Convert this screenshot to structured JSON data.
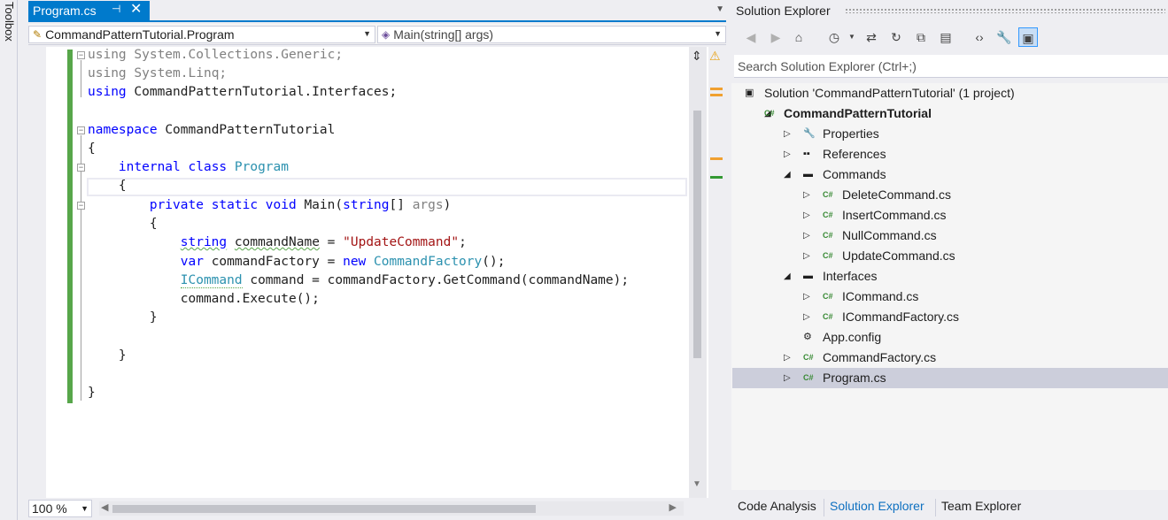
{
  "toolbox": {
    "label": "Toolbox"
  },
  "editor": {
    "tab": {
      "label": "Program.cs",
      "pin": "⊣",
      "close": "✕"
    },
    "nav": {
      "class_dropdown": "CommandPatternTutorial.Program",
      "member_dropdown": "Main(string[] args)"
    },
    "zoom": "100 %",
    "code": [
      [
        {
          "t": "using ",
          "c": "gr"
        },
        {
          "t": "System.Collections.Generic;",
          "c": "gr"
        }
      ],
      [
        {
          "t": "using ",
          "c": "gr"
        },
        {
          "t": "System.Linq;",
          "c": "gr"
        }
      ],
      [
        {
          "t": "using ",
          "c": "kw"
        },
        {
          "t": "CommandPatternTutorial.Interfaces;",
          "c": ""
        }
      ],
      [],
      [
        {
          "t": "namespace ",
          "c": "kw"
        },
        {
          "t": "CommandPatternTutorial",
          "c": ""
        }
      ],
      [
        {
          "t": "{",
          "c": ""
        }
      ],
      [
        {
          "t": "    internal ",
          "c": "kw"
        },
        {
          "t": "class ",
          "c": "kw"
        },
        {
          "t": "Program",
          "c": "ty"
        }
      ],
      [
        {
          "t": "    {",
          "c": ""
        }
      ],
      [
        {
          "t": "        private ",
          "c": "kw"
        },
        {
          "t": "static ",
          "c": "kw"
        },
        {
          "t": "void ",
          "c": "kw"
        },
        {
          "t": "Main(",
          "c": ""
        },
        {
          "t": "string",
          "c": "kw"
        },
        {
          "t": "[] ",
          "c": ""
        },
        {
          "t": "args",
          "c": "gr"
        },
        {
          "t": ")",
          "c": ""
        }
      ],
      [
        {
          "t": "        {",
          "c": ""
        }
      ],
      [
        {
          "t": "            ",
          "c": ""
        },
        {
          "t": "string",
          "c": "kw squig"
        },
        {
          "t": " ",
          "c": ""
        },
        {
          "t": "commandName",
          "c": "squig"
        },
        {
          "t": " = ",
          "c": ""
        },
        {
          "t": "\"UpdateCommand\"",
          "c": "st"
        },
        {
          "t": ";",
          "c": ""
        }
      ],
      [
        {
          "t": "            var ",
          "c": "kw"
        },
        {
          "t": "commandFactory = ",
          "c": ""
        },
        {
          "t": "new ",
          "c": "kw"
        },
        {
          "t": "CommandFactory",
          "c": "ty"
        },
        {
          "t": "();",
          "c": ""
        }
      ],
      [
        {
          "t": "            ",
          "c": ""
        },
        {
          "t": "ICommand",
          "c": "ty dotted"
        },
        {
          "t": " command = commandFactory.GetCommand(commandName);",
          "c": ""
        }
      ],
      [
        {
          "t": "            command.Execute();",
          "c": ""
        }
      ],
      [
        {
          "t": "        }",
          "c": ""
        }
      ],
      [],
      [
        {
          "t": "    }",
          "c": ""
        }
      ],
      [],
      [
        {
          "t": "}",
          "c": ""
        }
      ]
    ]
  },
  "solution_explorer": {
    "title": "Solution Explorer",
    "search_placeholder": "Search Solution Explorer (Ctrl+;)",
    "toolbar": [
      "back-icon",
      "forward-icon",
      "home-icon",
      "history-icon",
      "sync-icon",
      "refresh-icon",
      "collapse-all-icon",
      "show-all-files-icon",
      "view-code-icon",
      "properties-icon",
      "preview-icon"
    ],
    "tree": [
      {
        "label": "Solution 'CommandPatternTutorial' (1 project)",
        "level": 0,
        "exp": "",
        "icon": "solution-icon",
        "glyph": "▣"
      },
      {
        "label": "CommandPatternTutorial",
        "level": 0,
        "exp": "◢",
        "icon": "csharp-project-icon",
        "glyph": "C#",
        "bold": true
      },
      {
        "label": "Properties",
        "level": 1,
        "exp": "▷",
        "icon": "wrench-icon",
        "glyph": "🔧"
      },
      {
        "label": "References",
        "level": 1,
        "exp": "▷",
        "icon": "references-icon",
        "glyph": "▪▪"
      },
      {
        "label": "Commands",
        "level": 1,
        "exp": "◢",
        "icon": "folder-icon",
        "glyph": "▬"
      },
      {
        "label": "DeleteCommand.cs",
        "level": 2,
        "exp": "▷",
        "icon": "csharp-file-icon",
        "glyph": "C#"
      },
      {
        "label": "InsertCommand.cs",
        "level": 2,
        "exp": "▷",
        "icon": "csharp-file-icon",
        "glyph": "C#"
      },
      {
        "label": "NullCommand.cs",
        "level": 2,
        "exp": "▷",
        "icon": "csharp-file-icon",
        "glyph": "C#"
      },
      {
        "label": "UpdateCommand.cs",
        "level": 2,
        "exp": "▷",
        "icon": "csharp-file-icon",
        "glyph": "C#"
      },
      {
        "label": "Interfaces",
        "level": 1,
        "exp": "◢",
        "icon": "folder-icon",
        "glyph": "▬"
      },
      {
        "label": "ICommand.cs",
        "level": 2,
        "exp": "▷",
        "icon": "csharp-file-icon",
        "glyph": "C#"
      },
      {
        "label": "ICommandFactory.cs",
        "level": 2,
        "exp": "▷",
        "icon": "csharp-file-icon",
        "glyph": "C#"
      },
      {
        "label": "App.config",
        "level": 1,
        "exp": "",
        "icon": "config-icon",
        "glyph": "⚙"
      },
      {
        "label": "CommandFactory.cs",
        "level": 1,
        "exp": "▷",
        "icon": "csharp-file-icon",
        "glyph": "C#"
      },
      {
        "label": "Program.cs",
        "level": 1,
        "exp": "▷",
        "icon": "csharp-file-icon",
        "glyph": "C#",
        "selected": true
      }
    ],
    "bottom_tabs": [
      {
        "label": "Code Analysis",
        "active": false
      },
      {
        "label": "Solution Explorer",
        "active": true
      },
      {
        "label": "Team Explorer",
        "active": false
      }
    ]
  },
  "colors": {
    "accent": "#007ACC",
    "keyword": "#0000FF",
    "type": "#2B91AF",
    "string": "#A31515",
    "change_bar": "#57A64A"
  }
}
